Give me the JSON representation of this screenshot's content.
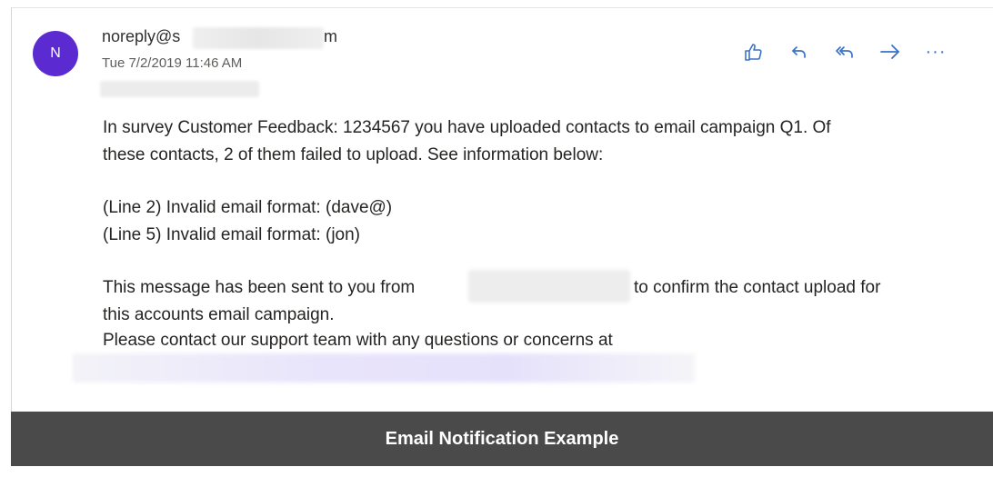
{
  "email": {
    "avatar_initial": "N",
    "sender_visible": "noreply@s",
    "sender_tail": "m",
    "timestamp": "Tue 7/2/2019 11:46 AM",
    "body": {
      "line1": "In survey Customer Feedback: 1234567 you have uploaded contacts to email campaign Q1. Of",
      "line2": "these contacts, 2 of them failed to upload.  See information below:",
      "error1": "(Line 2) Invalid email format: (dave@)",
      "error2": "(Line 5) Invalid email format: (jon)",
      "sent_from_prefix": "This message has been sent to you from",
      "sent_from_suffix": "to confirm the contact upload for",
      "line_campaign": "this accounts email campaign.",
      "support_line": "Please contact our support team with any questions or concerns at"
    },
    "actions": {
      "like": "thumbs-up-icon",
      "reply": "reply-icon",
      "reply_all": "reply-all-icon",
      "forward": "forward-icon",
      "more": "···"
    }
  },
  "banner": {
    "title": "Email Notification Example"
  },
  "colors": {
    "avatar_bg": "#5b2bd1",
    "action_icons": "#3a72c9",
    "banner_bg": "#4a4a4a"
  }
}
